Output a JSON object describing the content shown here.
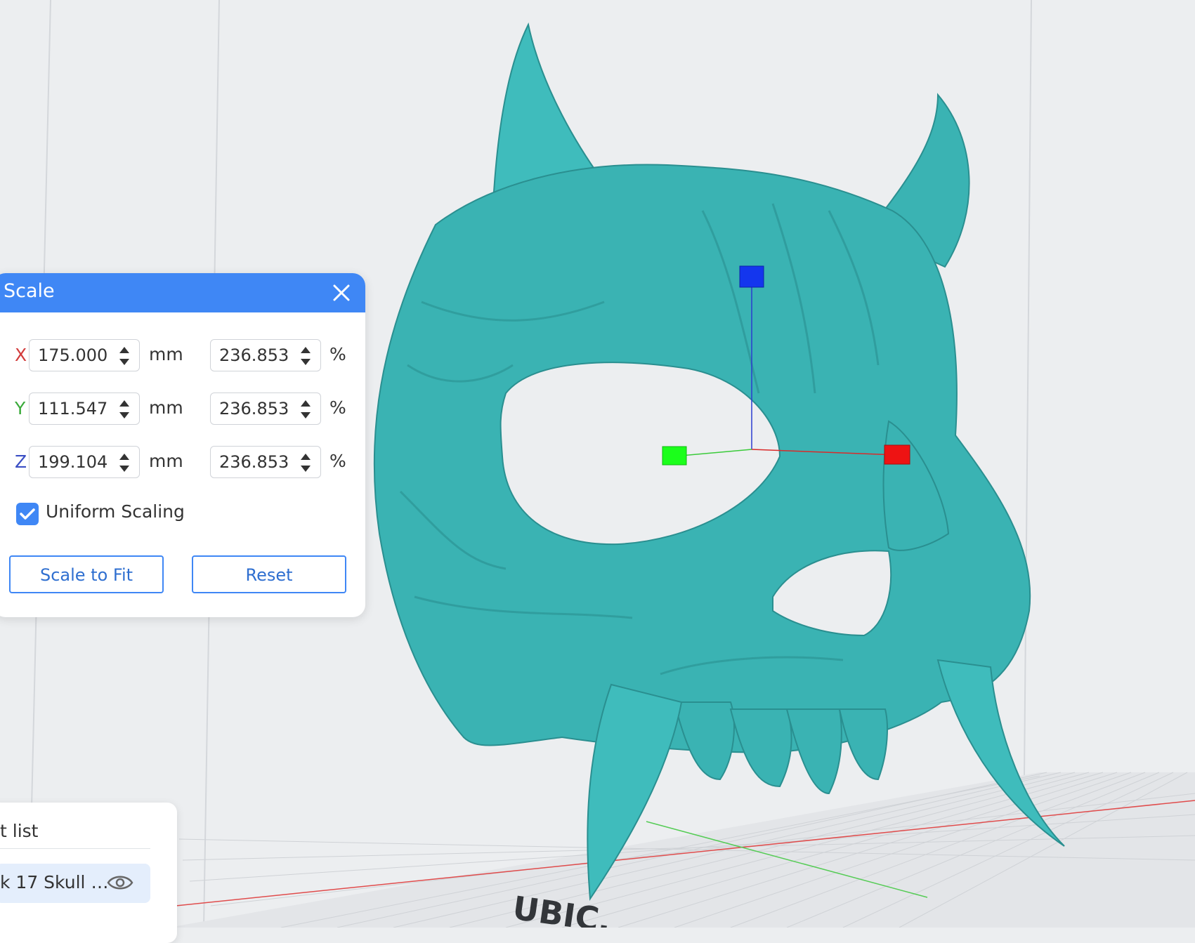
{
  "scale_panel": {
    "title": "Scale",
    "rows": [
      {
        "axis": "X",
        "color": "#d23c3c",
        "size": "175.000",
        "size_unit": "mm",
        "percent": "236.853",
        "percent_unit": "%"
      },
      {
        "axis": "Y",
        "color": "#3aaa3a",
        "size": "111.547",
        "size_unit": "mm",
        "percent": "236.853",
        "percent_unit": "%"
      },
      {
        "axis": "Z",
        "color": "#3b4fc4",
        "size": "199.104",
        "size_unit": "mm",
        "percent": "236.853",
        "percent_unit": "%"
      }
    ],
    "uniform_scaling_label": "Uniform Scaling",
    "uniform_scaling_checked": true,
    "scale_to_fit_label": "Scale to Fit",
    "reset_label": "Reset"
  },
  "object_list": {
    "title": "t list",
    "item_name": "k 17 Skull …"
  },
  "viewport": {
    "plate_text": "UBIC.",
    "model_color": "#3ab3b3"
  }
}
